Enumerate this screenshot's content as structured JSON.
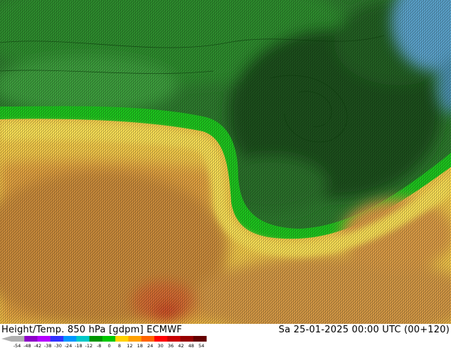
{
  "map": {
    "title": "Height/Temp. 850 hPa [gdpm] ECMWF",
    "datetime": "Sa 25-01-2025 00:00 UTC (00+120)"
  },
  "colorbar": {
    "ticks": [
      "-54",
      "-48",
      "-42",
      "-38",
      "-30",
      "-24",
      "-18",
      "-12",
      "-8",
      "0",
      "8",
      "12",
      "18",
      "24",
      "30",
      "36",
      "42",
      "48",
      "54"
    ],
    "segment_colors": [
      "#b0b0b0",
      "#8c00c8",
      "#b400ff",
      "#3232ff",
      "#0096ff",
      "#00c8c8",
      "#009600",
      "#00c800",
      "#ffd200",
      "#ffa000",
      "#ff6400",
      "#ff0000",
      "#c80000",
      "#960000",
      "#640000"
    ]
  },
  "colors": {
    "cold_green_dark": "#1f5e1f",
    "green_mid": "#3e9e3e",
    "green_bright": "#1ec41e",
    "yellow": "#f5d742",
    "orange": "#e0a040",
    "orange_brown": "#c88a3a",
    "warm_core": "#d06a30",
    "arctic_blue": "#5aa0c8"
  }
}
